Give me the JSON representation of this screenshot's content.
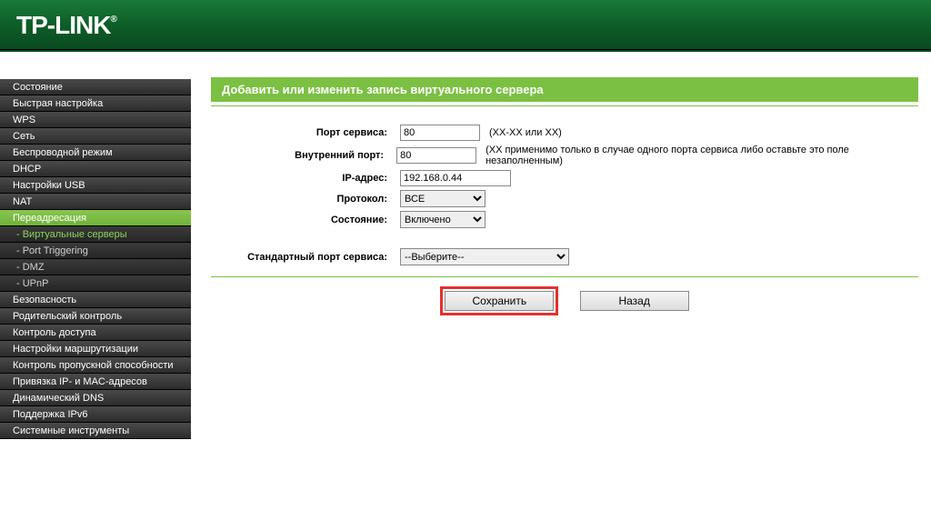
{
  "brand": "TP-LINK",
  "nav": {
    "status": "Состояние",
    "quick": "Быстрая настройка",
    "wps": "WPS",
    "network": "Сеть",
    "wireless": "Беспроводной режим",
    "dhcp": "DHCP",
    "usb": "Настройки USB",
    "nat": "NAT",
    "forwarding": "Переадресация",
    "sub_virtual": "- Виртуальные серверы",
    "sub_trigger": "- Port Triggering",
    "sub_dmz": "- DMZ",
    "sub_upnp": "- UPnP",
    "security": "Безопасность",
    "parental": "Родительский контроль",
    "access": "Контроль доступа",
    "routing": "Настройки маршрутизации",
    "bandwidth": "Контроль пропускной способности",
    "binding": "Привязка IP- и MAC-адресов",
    "ddns": "Динамический DNS",
    "ipv6": "Поддержка IPv6",
    "system": "Системные инструменты"
  },
  "page": {
    "title": "Добавить или изменить запись виртуального сервера",
    "service_port_label": "Порт сервиса:",
    "service_port_value": "80",
    "service_port_hint": "(XX-XX или XX)",
    "internal_port_label": "Внутренний порт:",
    "internal_port_value": "80",
    "internal_port_hint": "(XX применимо только в случае одного порта сервиса либо оставьте это поле незаполненным)",
    "ip_label": "IP-адрес:",
    "ip_value": "192.168.0.44",
    "protocol_label": "Протокол:",
    "protocol_value": "ВСЕ",
    "state_label": "Состояние:",
    "state_value": "Включено",
    "common_port_label": "Стандартный порт сервиса:",
    "common_port_value": "--Выберите--",
    "save": "Сохранить",
    "back": "Назад"
  }
}
